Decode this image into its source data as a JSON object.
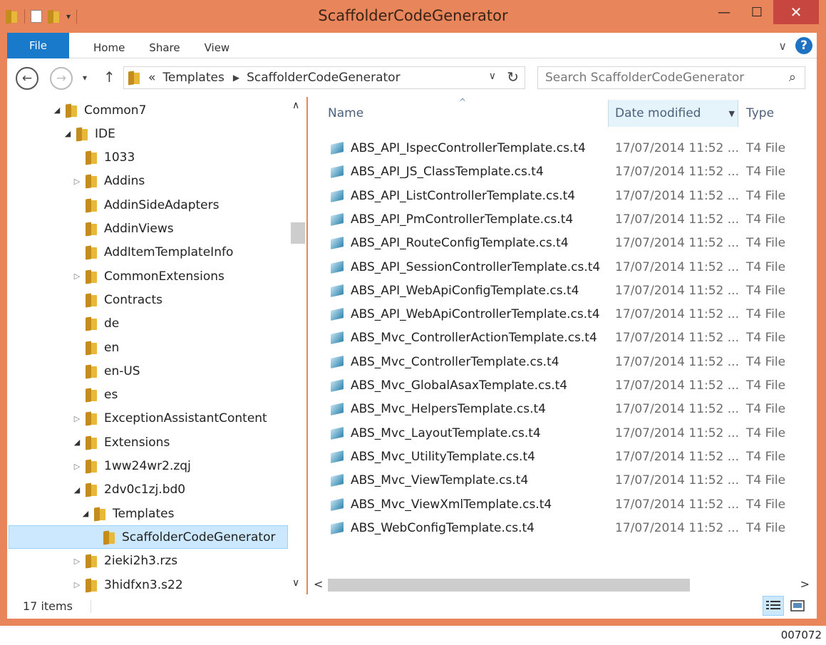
{
  "window": {
    "title": "ScaffolderCodeGenerator",
    "minimize": "—",
    "maximize": "☐",
    "close": "✕"
  },
  "ribbon": {
    "file": "File",
    "tabs": [
      "Home",
      "Share",
      "View"
    ],
    "expand_glyph": "∨",
    "help_glyph": "?"
  },
  "nav": {
    "back_glyph": "←",
    "forward_glyph": "→",
    "recent_glyph": "▾",
    "up_glyph": "↑",
    "overflow": "«",
    "breadcrumb": [
      "Templates",
      "ScaffolderCodeGenerator"
    ],
    "crumb_sep": "▶",
    "dropdown_glyph": "∨",
    "refresh_glyph": "↻",
    "search_placeholder": "Search ScaffolderCodeGenerator",
    "search_glyph": "⌕"
  },
  "tree": [
    {
      "label": "Common7",
      "indent": 0,
      "exp": "◢"
    },
    {
      "label": "IDE",
      "indent": 1,
      "exp": "◢"
    },
    {
      "label": "1033",
      "indent": 2,
      "exp": ""
    },
    {
      "label": "Addins",
      "indent": 2,
      "exp": "▷"
    },
    {
      "label": "AddinSideAdapters",
      "indent": 2,
      "exp": ""
    },
    {
      "label": "AddinViews",
      "indent": 2,
      "exp": ""
    },
    {
      "label": "AddItemTemplateInfo",
      "indent": 2,
      "exp": ""
    },
    {
      "label": "CommonExtensions",
      "indent": 2,
      "exp": "▷"
    },
    {
      "label": "Contracts",
      "indent": 2,
      "exp": ""
    },
    {
      "label": "de",
      "indent": 2,
      "exp": ""
    },
    {
      "label": "en",
      "indent": 2,
      "exp": ""
    },
    {
      "label": "en-US",
      "indent": 2,
      "exp": ""
    },
    {
      "label": "es",
      "indent": 2,
      "exp": ""
    },
    {
      "label": "ExceptionAssistantContent",
      "indent": 2,
      "exp": "▷"
    },
    {
      "label": "Extensions",
      "indent": 2,
      "exp": "◢"
    },
    {
      "label": "1ww24wr2.zqj",
      "indent": 3,
      "exp": "▷"
    },
    {
      "label": "2dv0c1zj.bd0",
      "indent": 3,
      "exp": "◢"
    },
    {
      "label": "Templates",
      "indent": 4,
      "exp": "◢"
    },
    {
      "label": "ScaffolderCodeGenerator",
      "indent": 5,
      "exp": "",
      "selected": true
    },
    {
      "label": "2ieki2h3.rzs",
      "indent": 3,
      "exp": "▷"
    },
    {
      "label": "3hidfxn3.s22",
      "indent": 3,
      "exp": "▷"
    }
  ],
  "tree_scroll": {
    "up": "∧",
    "down": "∨"
  },
  "columns": {
    "name": "Name",
    "date": "Date modified",
    "type": "Type",
    "sort_glyph": "^",
    "dropdown_glyph": "▼"
  },
  "files": [
    {
      "name": "ABS_API_IspecControllerTemplate.cs.t4",
      "date": "17/07/2014 11:52 ...",
      "type": "T4 File"
    },
    {
      "name": "ABS_API_JS_ClassTemplate.cs.t4",
      "date": "17/07/2014 11:52 ...",
      "type": "T4 File"
    },
    {
      "name": "ABS_API_ListControllerTemplate.cs.t4",
      "date": "17/07/2014 11:52 ...",
      "type": "T4 File"
    },
    {
      "name": "ABS_API_PmControllerTemplate.cs.t4",
      "date": "17/07/2014 11:52 ...",
      "type": "T4 File"
    },
    {
      "name": "ABS_API_RouteConfigTemplate.cs.t4",
      "date": "17/07/2014 11:52 ...",
      "type": "T4 File"
    },
    {
      "name": "ABS_API_SessionControllerTemplate.cs.t4",
      "date": "17/07/2014 11:52 ...",
      "type": "T4 File"
    },
    {
      "name": "ABS_API_WebApiConfigTemplate.cs.t4",
      "date": "17/07/2014 11:52 ...",
      "type": "T4 File"
    },
    {
      "name": "ABS_API_WebApiControllerTemplate.cs.t4",
      "date": "17/07/2014 11:52 ...",
      "type": "T4 File"
    },
    {
      "name": "ABS_Mvc_ControllerActionTemplate.cs.t4",
      "date": "17/07/2014 11:52 ...",
      "type": "T4 File"
    },
    {
      "name": "ABS_Mvc_ControllerTemplate.cs.t4",
      "date": "17/07/2014 11:52 ...",
      "type": "T4 File"
    },
    {
      "name": "ABS_Mvc_GlobalAsaxTemplate.cs.t4",
      "date": "17/07/2014 11:52 ...",
      "type": "T4 File"
    },
    {
      "name": "ABS_Mvc_HelpersTemplate.cs.t4",
      "date": "17/07/2014 11:52 ...",
      "type": "T4 File"
    },
    {
      "name": "ABS_Mvc_LayoutTemplate.cs.t4",
      "date": "17/07/2014 11:52 ...",
      "type": "T4 File"
    },
    {
      "name": "ABS_Mvc_UtilityTemplate.cs.t4",
      "date": "17/07/2014 11:52 ...",
      "type": "T4 File"
    },
    {
      "name": "ABS_Mvc_ViewTemplate.cs.t4",
      "date": "17/07/2014 11:52 ...",
      "type": "T4 File"
    },
    {
      "name": "ABS_Mvc_ViewXmlTemplate.cs.t4",
      "date": "17/07/2014 11:52 ...",
      "type": "T4 File"
    },
    {
      "name": "ABS_WebConfigTemplate.cs.t4",
      "date": "17/07/2014 11:52 ...",
      "type": "T4 File"
    }
  ],
  "hscroll": {
    "left": "<",
    "right": ">"
  },
  "status": {
    "count": "17 items"
  },
  "figure_id": "007072",
  "colors": {
    "frame": "#e9855a",
    "file_tab": "#1979ca",
    "selection": "#cce8ff",
    "close": "#c74740"
  }
}
